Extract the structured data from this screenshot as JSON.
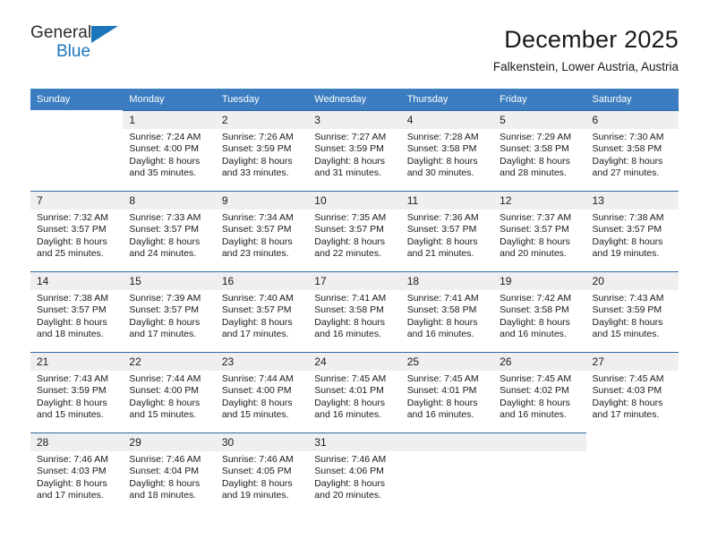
{
  "logo": {
    "word_top": "General",
    "word_bottom": "Blue",
    "accent_color": "#1b75bb"
  },
  "header": {
    "title": "December 2025",
    "subtitle": "Falkenstein, Lower Austria, Austria"
  },
  "calendar": {
    "header_bg": "#3b7dc0",
    "row_border_color": "#2e6aa8",
    "daynum_bg": "#efefef",
    "weekdays": [
      "Sunday",
      "Monday",
      "Tuesday",
      "Wednesday",
      "Thursday",
      "Friday",
      "Saturday"
    ],
    "weeks": [
      [
        {
          "day": "",
          "sunrise": "",
          "sunset": "",
          "daylight_line1": "",
          "daylight_line2": "",
          "empty": true
        },
        {
          "day": "1",
          "sunrise": "Sunrise: 7:24 AM",
          "sunset": "Sunset: 4:00 PM",
          "daylight_line1": "Daylight: 8 hours",
          "daylight_line2": "and 35 minutes.",
          "empty": false
        },
        {
          "day": "2",
          "sunrise": "Sunrise: 7:26 AM",
          "sunset": "Sunset: 3:59 PM",
          "daylight_line1": "Daylight: 8 hours",
          "daylight_line2": "and 33 minutes.",
          "empty": false
        },
        {
          "day": "3",
          "sunrise": "Sunrise: 7:27 AM",
          "sunset": "Sunset: 3:59 PM",
          "daylight_line1": "Daylight: 8 hours",
          "daylight_line2": "and 31 minutes.",
          "empty": false
        },
        {
          "day": "4",
          "sunrise": "Sunrise: 7:28 AM",
          "sunset": "Sunset: 3:58 PM",
          "daylight_line1": "Daylight: 8 hours",
          "daylight_line2": "and 30 minutes.",
          "empty": false
        },
        {
          "day": "5",
          "sunrise": "Sunrise: 7:29 AM",
          "sunset": "Sunset: 3:58 PM",
          "daylight_line1": "Daylight: 8 hours",
          "daylight_line2": "and 28 minutes.",
          "empty": false
        },
        {
          "day": "6",
          "sunrise": "Sunrise: 7:30 AM",
          "sunset": "Sunset: 3:58 PM",
          "daylight_line1": "Daylight: 8 hours",
          "daylight_line2": "and 27 minutes.",
          "empty": false
        }
      ],
      [
        {
          "day": "7",
          "sunrise": "Sunrise: 7:32 AM",
          "sunset": "Sunset: 3:57 PM",
          "daylight_line1": "Daylight: 8 hours",
          "daylight_line2": "and 25 minutes.",
          "empty": false
        },
        {
          "day": "8",
          "sunrise": "Sunrise: 7:33 AM",
          "sunset": "Sunset: 3:57 PM",
          "daylight_line1": "Daylight: 8 hours",
          "daylight_line2": "and 24 minutes.",
          "empty": false
        },
        {
          "day": "9",
          "sunrise": "Sunrise: 7:34 AM",
          "sunset": "Sunset: 3:57 PM",
          "daylight_line1": "Daylight: 8 hours",
          "daylight_line2": "and 23 minutes.",
          "empty": false
        },
        {
          "day": "10",
          "sunrise": "Sunrise: 7:35 AM",
          "sunset": "Sunset: 3:57 PM",
          "daylight_line1": "Daylight: 8 hours",
          "daylight_line2": "and 22 minutes.",
          "empty": false
        },
        {
          "day": "11",
          "sunrise": "Sunrise: 7:36 AM",
          "sunset": "Sunset: 3:57 PM",
          "daylight_line1": "Daylight: 8 hours",
          "daylight_line2": "and 21 minutes.",
          "empty": false
        },
        {
          "day": "12",
          "sunrise": "Sunrise: 7:37 AM",
          "sunset": "Sunset: 3:57 PM",
          "daylight_line1": "Daylight: 8 hours",
          "daylight_line2": "and 20 minutes.",
          "empty": false
        },
        {
          "day": "13",
          "sunrise": "Sunrise: 7:38 AM",
          "sunset": "Sunset: 3:57 PM",
          "daylight_line1": "Daylight: 8 hours",
          "daylight_line2": "and 19 minutes.",
          "empty": false
        }
      ],
      [
        {
          "day": "14",
          "sunrise": "Sunrise: 7:38 AM",
          "sunset": "Sunset: 3:57 PM",
          "daylight_line1": "Daylight: 8 hours",
          "daylight_line2": "and 18 minutes.",
          "empty": false
        },
        {
          "day": "15",
          "sunrise": "Sunrise: 7:39 AM",
          "sunset": "Sunset: 3:57 PM",
          "daylight_line1": "Daylight: 8 hours",
          "daylight_line2": "and 17 minutes.",
          "empty": false
        },
        {
          "day": "16",
          "sunrise": "Sunrise: 7:40 AM",
          "sunset": "Sunset: 3:57 PM",
          "daylight_line1": "Daylight: 8 hours",
          "daylight_line2": "and 17 minutes.",
          "empty": false
        },
        {
          "day": "17",
          "sunrise": "Sunrise: 7:41 AM",
          "sunset": "Sunset: 3:58 PM",
          "daylight_line1": "Daylight: 8 hours",
          "daylight_line2": "and 16 minutes.",
          "empty": false
        },
        {
          "day": "18",
          "sunrise": "Sunrise: 7:41 AM",
          "sunset": "Sunset: 3:58 PM",
          "daylight_line1": "Daylight: 8 hours",
          "daylight_line2": "and 16 minutes.",
          "empty": false
        },
        {
          "day": "19",
          "sunrise": "Sunrise: 7:42 AM",
          "sunset": "Sunset: 3:58 PM",
          "daylight_line1": "Daylight: 8 hours",
          "daylight_line2": "and 16 minutes.",
          "empty": false
        },
        {
          "day": "20",
          "sunrise": "Sunrise: 7:43 AM",
          "sunset": "Sunset: 3:59 PM",
          "daylight_line1": "Daylight: 8 hours",
          "daylight_line2": "and 15 minutes.",
          "empty": false
        }
      ],
      [
        {
          "day": "21",
          "sunrise": "Sunrise: 7:43 AM",
          "sunset": "Sunset: 3:59 PM",
          "daylight_line1": "Daylight: 8 hours",
          "daylight_line2": "and 15 minutes.",
          "empty": false
        },
        {
          "day": "22",
          "sunrise": "Sunrise: 7:44 AM",
          "sunset": "Sunset: 4:00 PM",
          "daylight_line1": "Daylight: 8 hours",
          "daylight_line2": "and 15 minutes.",
          "empty": false
        },
        {
          "day": "23",
          "sunrise": "Sunrise: 7:44 AM",
          "sunset": "Sunset: 4:00 PM",
          "daylight_line1": "Daylight: 8 hours",
          "daylight_line2": "and 15 minutes.",
          "empty": false
        },
        {
          "day": "24",
          "sunrise": "Sunrise: 7:45 AM",
          "sunset": "Sunset: 4:01 PM",
          "daylight_line1": "Daylight: 8 hours",
          "daylight_line2": "and 16 minutes.",
          "empty": false
        },
        {
          "day": "25",
          "sunrise": "Sunrise: 7:45 AM",
          "sunset": "Sunset: 4:01 PM",
          "daylight_line1": "Daylight: 8 hours",
          "daylight_line2": "and 16 minutes.",
          "empty": false
        },
        {
          "day": "26",
          "sunrise": "Sunrise: 7:45 AM",
          "sunset": "Sunset: 4:02 PM",
          "daylight_line1": "Daylight: 8 hours",
          "daylight_line2": "and 16 minutes.",
          "empty": false
        },
        {
          "day": "27",
          "sunrise": "Sunrise: 7:45 AM",
          "sunset": "Sunset: 4:03 PM",
          "daylight_line1": "Daylight: 8 hours",
          "daylight_line2": "and 17 minutes.",
          "empty": false
        }
      ],
      [
        {
          "day": "28",
          "sunrise": "Sunrise: 7:46 AM",
          "sunset": "Sunset: 4:03 PM",
          "daylight_line1": "Daylight: 8 hours",
          "daylight_line2": "and 17 minutes.",
          "empty": false
        },
        {
          "day": "29",
          "sunrise": "Sunrise: 7:46 AM",
          "sunset": "Sunset: 4:04 PM",
          "daylight_line1": "Daylight: 8 hours",
          "daylight_line2": "and 18 minutes.",
          "empty": false
        },
        {
          "day": "30",
          "sunrise": "Sunrise: 7:46 AM",
          "sunset": "Sunset: 4:05 PM",
          "daylight_line1": "Daylight: 8 hours",
          "daylight_line2": "and 19 minutes.",
          "empty": false
        },
        {
          "day": "31",
          "sunrise": "Sunrise: 7:46 AM",
          "sunset": "Sunset: 4:06 PM",
          "daylight_line1": "Daylight: 8 hours",
          "daylight_line2": "and 20 minutes.",
          "empty": false
        },
        {
          "day": "",
          "sunrise": "",
          "sunset": "",
          "daylight_line1": "",
          "daylight_line2": "",
          "empty": false
        },
        {
          "day": "",
          "sunrise": "",
          "sunset": "",
          "daylight_line1": "",
          "daylight_line2": "",
          "empty": false
        },
        {
          "day": "",
          "sunrise": "",
          "sunset": "",
          "daylight_line1": "",
          "daylight_line2": "",
          "empty": true
        }
      ]
    ]
  }
}
